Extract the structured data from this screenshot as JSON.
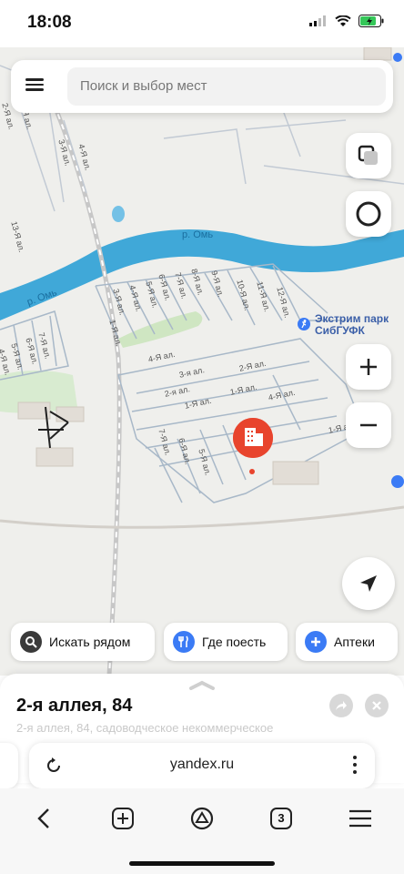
{
  "status": {
    "time": "18:08"
  },
  "search": {
    "placeholder": "Поиск и выбор мест"
  },
  "map": {
    "river_labels": [
      "р. Омь",
      "р. Омь"
    ],
    "poi": {
      "name": "Экстрим парк СибГУФК"
    },
    "alley_labels": [
      "1-Я ал.",
      "2-Я ал.",
      "3-Я ал.",
      "4-Я ал.",
      "5-Я ал.",
      "6-Я ал.",
      "7-Я ал.",
      "8-Я ал.",
      "9-Я ал.",
      "10-Я ал.",
      "11-Я ал.",
      "12-Я ал.",
      "13-Я ал.",
      "2-я ал.",
      "3-я ал."
    ]
  },
  "chips": [
    {
      "label": "Искать рядом",
      "icon": "search-icon",
      "color": "#3a3a3a"
    },
    {
      "label": "Где поесть",
      "icon": "fork-knife-icon",
      "color": "#3b7bf5"
    },
    {
      "label": "Аптеки",
      "icon": "plus-icon",
      "color": "#3b7bf5"
    }
  ],
  "place": {
    "title": "2-я аллея, 84",
    "subtitle": "2-я аллея, 84, садоводческое некоммерческое"
  },
  "browser": {
    "url": "yandex.ru",
    "tabs_count": "3"
  },
  "colors": {
    "river": "#40a8d8",
    "marker": "#e8442d",
    "accent": "#3b7bf5"
  }
}
